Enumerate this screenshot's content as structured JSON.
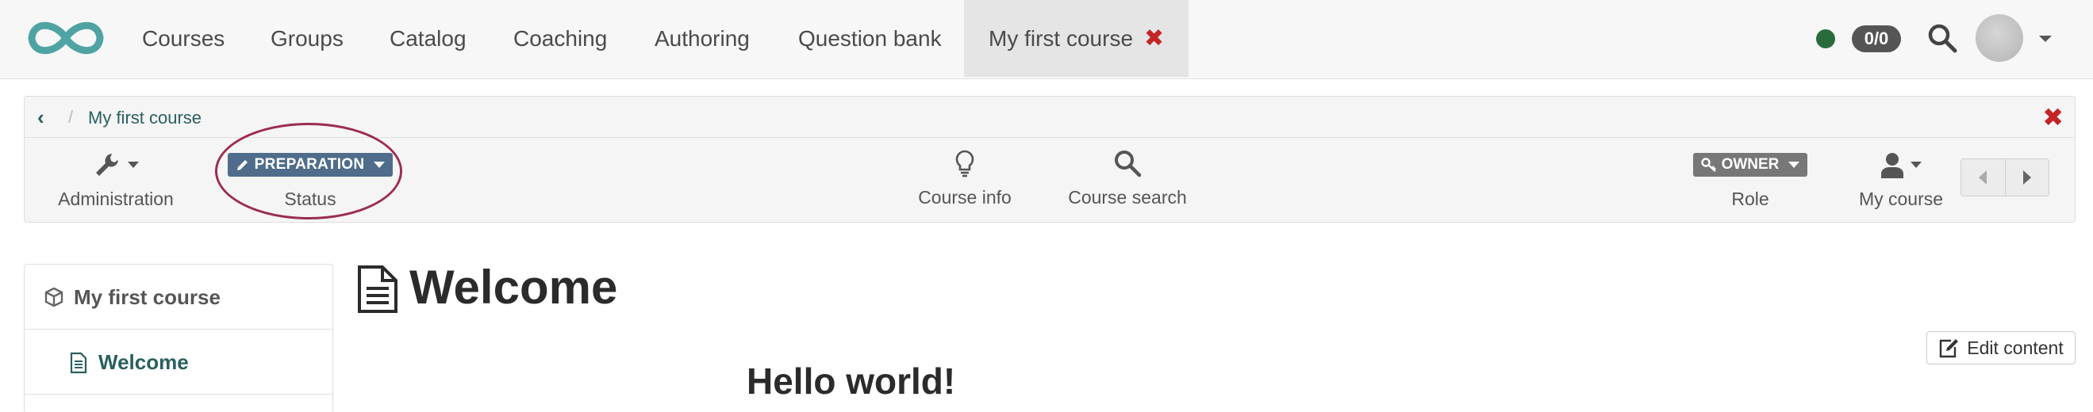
{
  "nav": {
    "items": [
      {
        "label": "Courses"
      },
      {
        "label": "Groups"
      },
      {
        "label": "Catalog"
      },
      {
        "label": "Coaching"
      },
      {
        "label": "Authoring"
      },
      {
        "label": "Question bank"
      }
    ],
    "active_tab": {
      "label": "My first course",
      "close_icon": "close-icon"
    },
    "online_status_color": "#2a6b3c",
    "counter": "0/0",
    "search_icon": "search-icon",
    "avatar_icon": "avatar"
  },
  "course_bar": {
    "breadcrumb": {
      "back_icon": "chevron-left-icon",
      "separator": "/",
      "current": "My first course"
    },
    "close_icon": "close-icon",
    "tools": {
      "administration": {
        "label": "Administration",
        "icon": "wrench-icon"
      },
      "status": {
        "badge": "PREPARATION",
        "label": "Status",
        "icon": "pencil-icon",
        "color": "#4f6d8a"
      },
      "course_info": {
        "label": "Course info",
        "icon": "lightbulb-icon"
      },
      "course_search": {
        "label": "Course search",
        "icon": "search-icon"
      },
      "role": {
        "badge": "OWNER",
        "label": "Role",
        "icon": "key-icon"
      },
      "my_course": {
        "label": "My course",
        "icon": "user-icon"
      }
    },
    "pager": {
      "prev_icon": "triangle-left-icon",
      "next_icon": "triangle-right-icon"
    }
  },
  "menu": {
    "root": {
      "label": "My first course",
      "icon": "cube-icon"
    },
    "items": [
      {
        "label": "Welcome",
        "icon": "file-text-icon"
      }
    ]
  },
  "content": {
    "title": "Welcome",
    "title_icon": "file-text-icon",
    "edit_button": "Edit content",
    "body_heading": "Hello world!"
  },
  "colors": {
    "accent": "#2a5f5f",
    "logo": "#4fa3a3",
    "close": "#c42424",
    "highlight": "#9b2d4e"
  }
}
